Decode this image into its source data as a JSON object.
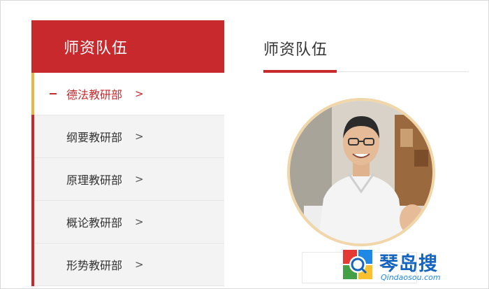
{
  "sidebar": {
    "header": "师资队伍",
    "items": [
      {
        "label": "德法教研部",
        "arrow": ">"
      },
      {
        "label": "纲要教研部",
        "arrow": ">"
      },
      {
        "label": "原理教研部",
        "arrow": ">"
      },
      {
        "label": "概论教研部",
        "arrow": ">"
      },
      {
        "label": "形势教研部",
        "arrow": ">"
      }
    ]
  },
  "main": {
    "title": "师资队伍"
  },
  "watermark": {
    "brand": "琴岛搜",
    "url": "Qindaosou.com"
  },
  "colors": {
    "accent": "#c8292c",
    "active_marker": "#e6b64b",
    "portrait_ring": "#f0d6a8",
    "watermark_blue": "#1565c0"
  }
}
